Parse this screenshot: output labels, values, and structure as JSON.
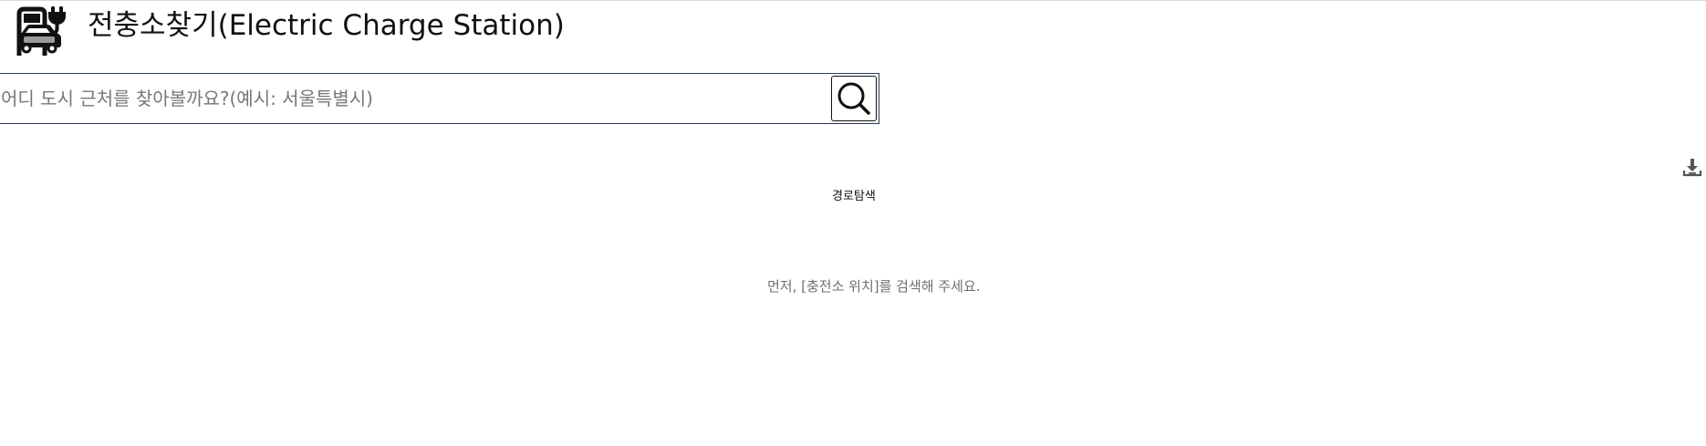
{
  "header": {
    "title": "전충소찾기(Electric Charge Station)",
    "logo_icon": "ev-charging-car-icon"
  },
  "search": {
    "placeholder": "어디 도시 근처를 찾아볼까요?(예시: 서울특별시)",
    "value": "",
    "button_icon": "search-icon"
  },
  "toolbar": {
    "download_icon": "download-icon"
  },
  "route": {
    "label": "경로탐색"
  },
  "results": {
    "empty_message": "먼저, [충전소 위치]를 검색해 주세요."
  },
  "colors": {
    "border": "#2b3a55",
    "text": "#111111",
    "muted": "#6f6f6f"
  }
}
